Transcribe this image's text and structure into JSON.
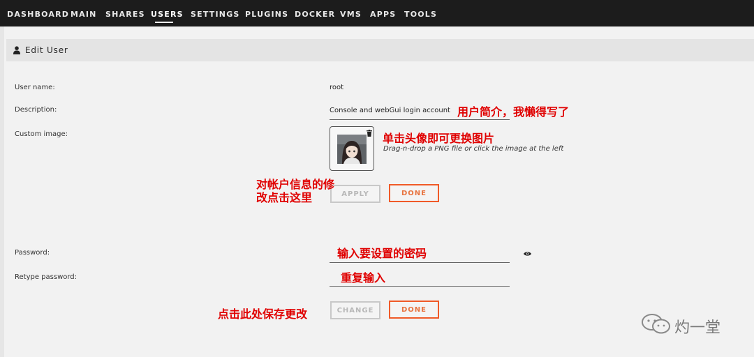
{
  "nav": {
    "items": [
      "DASHBOARD",
      "MAIN",
      "SHARES",
      "USERS",
      "SETTINGS",
      "PLUGINS",
      "DOCKER",
      "VMS",
      "APPS",
      "TOOLS"
    ],
    "active": "USERS"
  },
  "header": {
    "title": "Edit User",
    "icon": "user-icon"
  },
  "form": {
    "username_label": "User name:",
    "username_value": "root",
    "description_label": "Description:",
    "description_value": "Console and webGui login account",
    "custom_image_label": "Custom image:",
    "image_hint": "Drag-n-drop a PNG file or click the image at the left",
    "apply_label": "APPLY",
    "done_label": "DONE",
    "password_label": "Password:",
    "retype_label": "Retype password:",
    "change_label": "CHANGE",
    "done2_label": "DONE"
  },
  "annotations": {
    "description": "用户简介，我懒得写了",
    "avatar": "单击头像即可更换图片",
    "apply_line1": "对帐户信息的修",
    "apply_line2": "改点击这里",
    "password": "输入要设置的密码",
    "retype": "重复输入",
    "change": "点击此处保存更改"
  },
  "watermark": {
    "text": "灼一堂",
    "icon": "wechat-icon"
  },
  "colors": {
    "nav_bg": "#1c1c1c",
    "accent": "#f05a28",
    "annotation": "#e00000"
  }
}
